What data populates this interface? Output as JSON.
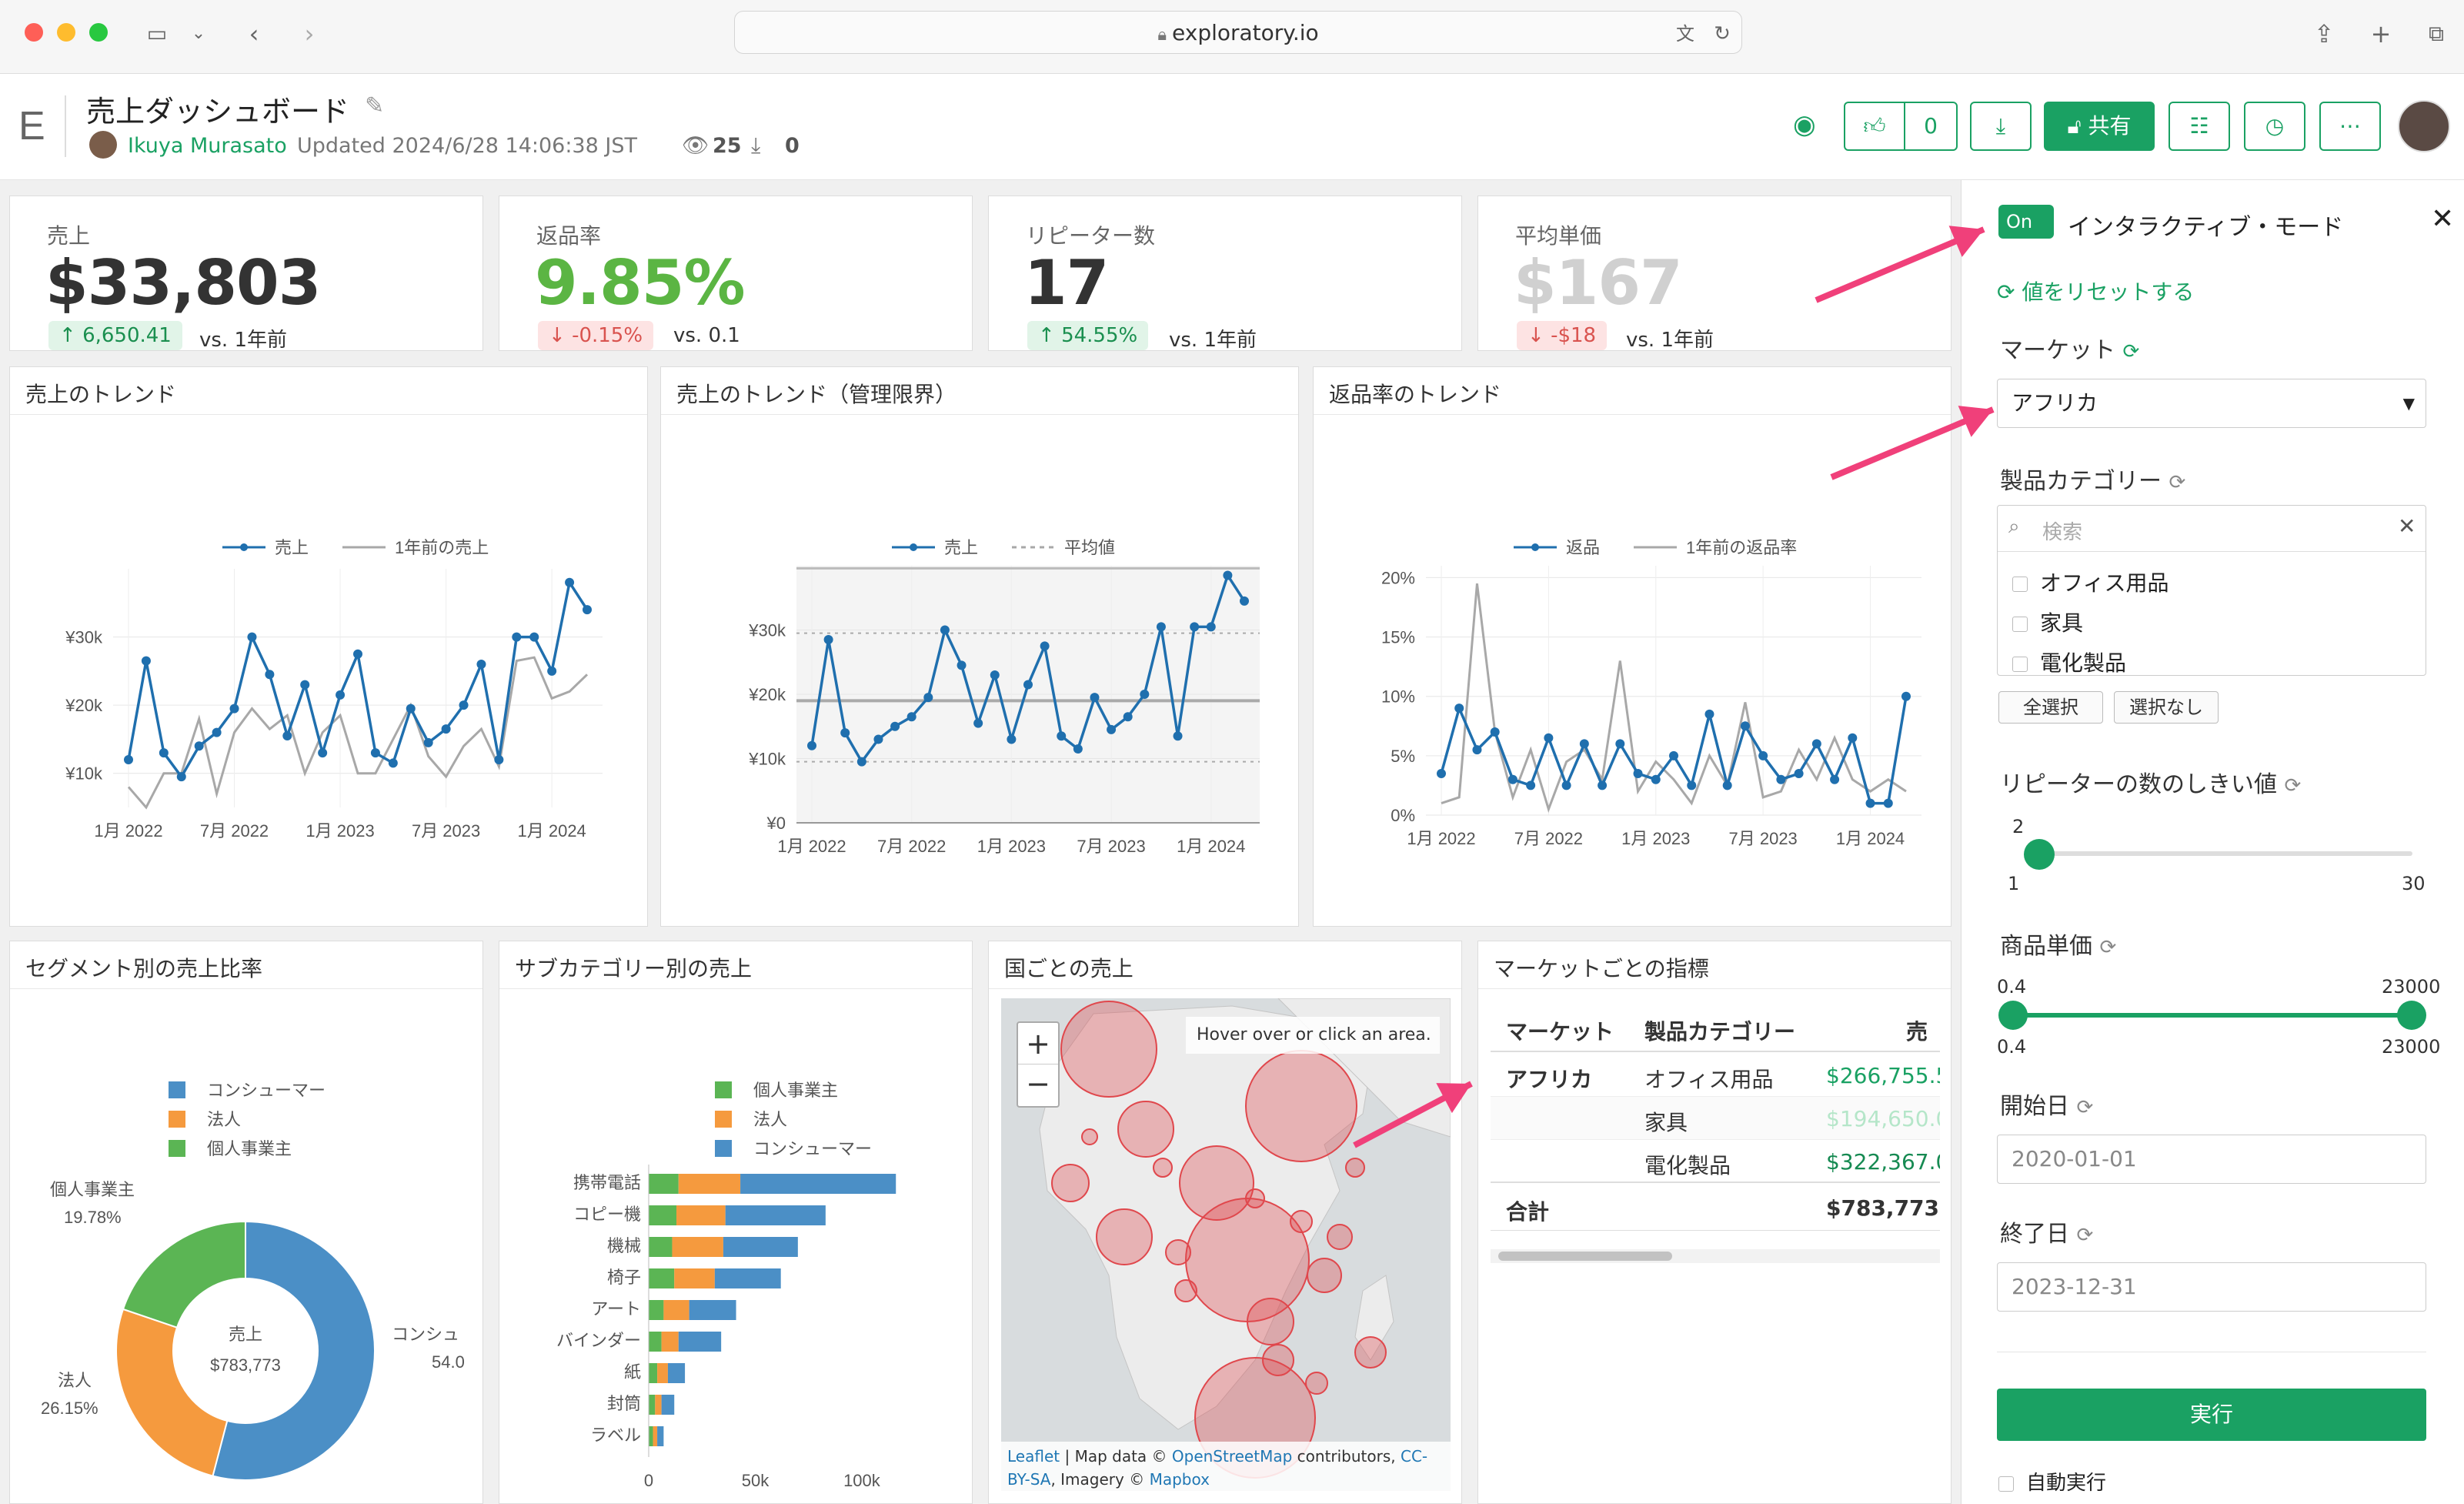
{
  "browser": {
    "url": "exploratory.io"
  },
  "header": {
    "logo": "E",
    "title": "売上ダッシュボード",
    "author": "Ikuya Murasato",
    "updated": "Updated 2024/6/28 14:06:38 JST",
    "views": "25",
    "downloads": "0",
    "like_count": "0",
    "share_label": "共有"
  },
  "kpis": [
    {
      "label": "売上",
      "value": "$33,803",
      "delta": "6,650.41",
      "vs": "vs. 1年前",
      "delta_dir": "up",
      "value_color": "#333333"
    },
    {
      "label": "返品率",
      "value": "9.85%",
      "delta": "-0.15%",
      "vs": "vs. 0.1",
      "delta_dir": "down",
      "value_color": "#5bb543"
    },
    {
      "label": "リピーター数",
      "value": "17",
      "delta": "54.55%",
      "vs": "vs. 1年前",
      "delta_dir": "up",
      "value_color": "#333333"
    },
    {
      "label": "平均単価",
      "value": "$167",
      "delta": "-$18",
      "vs": "vs. 1年前",
      "delta_dir": "down",
      "value_color": "#d0d0d0"
    }
  ],
  "charts": {
    "sales_trend": {
      "title": "売上のトレンド",
      "legend": [
        "売上",
        "1年前の売上"
      ]
    },
    "control_chart": {
      "title": "売上のトレンド（管理限界）",
      "legend": [
        "売上",
        "平均値"
      ]
    },
    "return_trend": {
      "title": "返品率のトレンド",
      "legend": [
        "返品",
        "1年前の返品率"
      ]
    },
    "segment": {
      "title": "セグメント別の売上比率",
      "legend": [
        "コンシューマー",
        "法人",
        "個人事業主"
      ],
      "center_label": "売上",
      "center_value": "$783,773",
      "labels": [
        {
          "name": "個人事業主",
          "pct": "19.78%"
        },
        {
          "name": "法人",
          "pct": "26.15%"
        },
        {
          "name": "コンシュ",
          "pct": "54.0"
        }
      ]
    },
    "subcategory": {
      "title": "サブカテゴリー別の売上",
      "legend": [
        "個人事業主",
        "法人",
        "コンシューマー"
      ],
      "xlabel": "売上"
    },
    "map": {
      "title": "国ごとの売上",
      "hover_text": "Hover over or click an area.",
      "attribution_1": "Leaflet",
      "attribution_2": " | Map data © ",
      "attribution_3": "OpenStreetMap",
      "attribution_4": " contributors, ",
      "attribution_5": "CC-BY-SA",
      "attribution_6": ", Imagery © ",
      "attribution_7": "Mapbox"
    },
    "market_table": {
      "title": "マーケットごとの指標",
      "headers": [
        "マーケット",
        "製品カテゴリー",
        "売"
      ],
      "rows": [
        {
          "market": "アフリカ",
          "category": "オフィス用品",
          "sales": "$266,755.5"
        },
        {
          "market": "",
          "category": "家具",
          "sales": "$194,650.0"
        },
        {
          "market": "",
          "category": "電化製品",
          "sales": "$322,367.0"
        }
      ],
      "total_label": "合計",
      "total_value": "$783,773.2"
    }
  },
  "chart_data": [
    {
      "type": "line",
      "title": "売上のトレンド",
      "x_ticks": [
        "1月 2022",
        "7月 2022",
        "1月 2023",
        "7月 2023",
        "1月 2024"
      ],
      "y_ticks": [
        "¥10k",
        "¥20k",
        "¥30k"
      ],
      "x": [
        "2022-01",
        "2022-02",
        "2022-03",
        "2022-04",
        "2022-05",
        "2022-06",
        "2022-07",
        "2022-08",
        "2022-09",
        "2022-10",
        "2022-11",
        "2022-12",
        "2023-01",
        "2023-02",
        "2023-03",
        "2023-04",
        "2023-05",
        "2023-06",
        "2023-07",
        "2023-08",
        "2023-09",
        "2023-10",
        "2023-11",
        "2023-12",
        "2024-01"
      ],
      "series": [
        {
          "name": "売上",
          "values": [
            12000,
            26500,
            13000,
            9500,
            14000,
            16000,
            19500,
            30000,
            24500,
            15500,
            23000,
            13000,
            21500,
            27500,
            13000,
            11500,
            19500,
            14500,
            16500,
            20000,
            26000,
            12000,
            30000,
            30000,
            25000,
            38000,
            34000
          ]
        },
        {
          "name": "1年前の売上",
          "values": [
            8000,
            5000,
            10000,
            10000,
            18000,
            7000,
            16000,
            19500,
            16500,
            18500,
            10000,
            16000,
            18500,
            10000,
            10000,
            15000,
            20000,
            12500,
            9500,
            14000,
            16500,
            11000,
            26500,
            27000,
            21000,
            22000,
            24500
          ]
        }
      ],
      "ylim": [
        5000,
        40000
      ]
    },
    {
      "type": "line",
      "title": "売上のトレンド（管理限界）",
      "x_ticks": [
        "1月 2022",
        "7月 2022",
        "1月 2023",
        "7月 2023",
        "1月 2024"
      ],
      "y_ticks": [
        "¥0",
        "¥10k",
        "¥20k",
        "¥30k"
      ],
      "series": [
        {
          "name": "売上",
          "values": [
            12000,
            28500,
            14000,
            9500,
            13000,
            15000,
            16500,
            19500,
            30000,
            24500,
            15500,
            23000,
            13000,
            21500,
            27500,
            13500,
            11500,
            19500,
            14500,
            16500,
            20000,
            30500,
            13500,
            30500,
            30500,
            38500,
            34500
          ]
        }
      ],
      "mean": 19000,
      "ucl": 29500,
      "lcl": 9500,
      "ylim": [
        0,
        40000
      ]
    },
    {
      "type": "line",
      "title": "返品率のトレンド",
      "x_ticks": [
        "1月 2022",
        "7月 2022",
        "1月 2023",
        "7月 2023",
        "1月 2024"
      ],
      "y_ticks": [
        "0%",
        "5%",
        "10%",
        "15%",
        "20%"
      ],
      "series": [
        {
          "name": "返品",
          "values": [
            3.5,
            9,
            5.5,
            7,
            3,
            2.5,
            6.5,
            2.5,
            6,
            2.5,
            6,
            3.5,
            3,
            5,
            2.5,
            8.5,
            2.5,
            7.5,
            5,
            3,
            3.5,
            6,
            3,
            6.5,
            1,
            1,
            10
          ]
        },
        {
          "name": "1年前の返品率",
          "values": [
            1,
            1.5,
            19.5,
            7,
            1.5,
            5.5,
            0.5,
            4.5,
            5.5,
            3,
            13,
            2,
            4.5,
            3,
            1,
            5,
            2.5,
            9.5,
            1.5,
            2,
            5.5,
            3,
            6.5,
            3,
            2,
            3,
            2
          ]
        }
      ],
      "ylim": [
        0,
        21
      ]
    },
    {
      "type": "pie",
      "title": "セグメント別の売上比率",
      "categories": [
        "コンシューマー",
        "法人",
        "個人事業主"
      ],
      "values": [
        54.07,
        26.15,
        19.78
      ]
    },
    {
      "type": "bar",
      "title": "サブカテゴリー別の売上",
      "orientation": "horizontal",
      "stacked": true,
      "xlabel": "売上",
      "x_ticks": [
        "0",
        "50k",
        "100k"
      ],
      "categories": [
        "携帯電話",
        "コピー機",
        "機械",
        "椅子",
        "アート",
        "バインダー",
        "紙",
        "封筒",
        "ラベル"
      ],
      "series": [
        {
          "name": "個人事業主",
          "values": [
            14000,
            13000,
            11000,
            12000,
            7000,
            6000,
            4000,
            3000,
            2000
          ]
        },
        {
          "name": "法人",
          "values": [
            29000,
            23000,
            24000,
            19000,
            12000,
            8000,
            5000,
            3000,
            2000
          ]
        },
        {
          "name": "コンシューマー",
          "values": [
            73000,
            47000,
            35000,
            31000,
            22000,
            20000,
            8000,
            6000,
            3000
          ]
        }
      ]
    }
  ],
  "sidebar": {
    "toggle": "On",
    "mode_label": "インタラクティブ・モード",
    "reset_label": "値をリセットする",
    "market_label": "マーケット",
    "market_value": "アフリカ",
    "category_label": "製品カテゴリー",
    "search_placeholder": "検索",
    "categories": [
      "オフィス用品",
      "家具",
      "電化製品"
    ],
    "select_all": "全選択",
    "select_none": "選択なし",
    "repeater_label": "リピーターの数のしきい値",
    "repeater_value": "2",
    "repeater_min": "1",
    "repeater_max": "30",
    "repeater_level": 0.03,
    "price_label": "商品単価",
    "price_low": "0.4",
    "price_high": "23000",
    "start_label": "開始日",
    "start_value": "2020-01-01",
    "end_label": "終了日",
    "end_value": "2023-12-31",
    "run_label": "実行",
    "auto_run_label": "自動実行"
  },
  "colors": {
    "brand_green": "#1aa163",
    "line_blue": "#1f6fae",
    "line_gray": "#a8a8a8",
    "arrow_pink": "#f0407a",
    "seg_blue": "#4b8fc6",
    "seg_orange": "#f59a3e",
    "seg_green": "#5bb554",
    "bubble_red": "#e0474c"
  }
}
